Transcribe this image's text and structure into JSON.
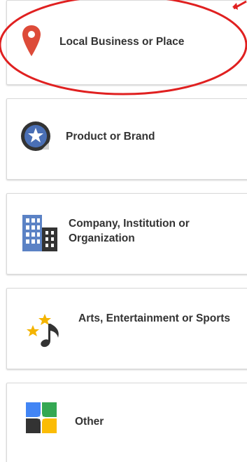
{
  "categories": [
    {
      "label": "Local Business or Place",
      "icon": "map-pin-icon"
    },
    {
      "label": "Product or Brand",
      "icon": "star-badge-icon"
    },
    {
      "label": "Company, Institution or Organization",
      "icon": "buildings-icon"
    },
    {
      "label": "Arts, Entertainment or Sports",
      "icon": "music-note-stars-icon"
    },
    {
      "label": "Other",
      "icon": "color-tiles-icon"
    }
  ],
  "colors": {
    "highlight": "#e02020",
    "pin": "#dd4b39",
    "badge": "#4a6fb5",
    "building": "#5b82c5",
    "building_dark": "#333333",
    "star": "#f4b400",
    "note": "#333333",
    "tile_blue": "#4285f4",
    "tile_green": "#34a853",
    "tile_yellow": "#fbbc05",
    "tile_dark": "#333333"
  }
}
